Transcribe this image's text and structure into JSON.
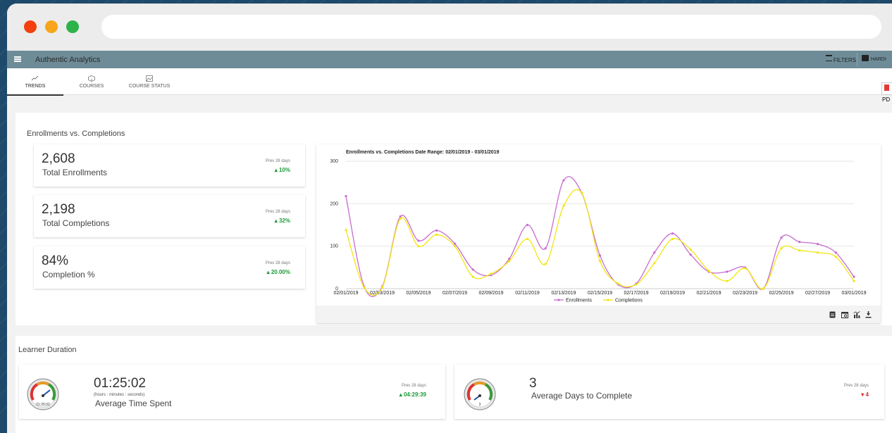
{
  "app": {
    "title": "Authentic Analytics",
    "filters_label": "FILTERS",
    "user_label": "HARDI"
  },
  "tabs": [
    {
      "label": "TRENDS",
      "icon": "line-chart-icon"
    },
    {
      "label": "COURSES",
      "icon": "cube-icon"
    },
    {
      "label": "COURSE STATUS",
      "icon": "image-icon"
    }
  ],
  "pdf_label": "PD",
  "enrollments": {
    "section_title": "Enrollments vs. Completions",
    "stats": [
      {
        "value": "2,608",
        "label": "Total Enrollments",
        "prev_label": "Prev 28 days",
        "change": "10%",
        "direction": "up"
      },
      {
        "value": "2,198",
        "label": "Total Completions",
        "prev_label": "Prev 28 days",
        "change": "32%",
        "direction": "up"
      },
      {
        "value": "84%",
        "label": "Completion %",
        "prev_label": "Prev 28 days",
        "change": "20.00%",
        "direction": "up"
      }
    ]
  },
  "chart_data": {
    "type": "line",
    "title": "Enrollments vs. Completions Date Range: 02/01/2019 - 03/01/2019",
    "ylim": [
      0,
      300
    ],
    "yticks": [
      0,
      100,
      200,
      300
    ],
    "x": [
      "02/01/2019",
      "02/02/2019",
      "02/03/2019",
      "02/04/2019",
      "02/05/2019",
      "02/06/2019",
      "02/07/2019",
      "02/08/2019",
      "02/09/2019",
      "02/10/2019",
      "02/11/2019",
      "02/12/2019",
      "02/13/2019",
      "02/14/2019",
      "02/15/2019",
      "02/16/2019",
      "02/17/2019",
      "02/18/2019",
      "02/19/2019",
      "02/20/2019",
      "02/21/2019",
      "02/22/2019",
      "02/23/2019",
      "02/24/2019",
      "02/25/2019",
      "02/26/2019",
      "02/27/2019",
      "02/28/2019",
      "03/01/2019"
    ],
    "xtick_labels": [
      "02/01/2019",
      "02/03/2019",
      "02/05/2019",
      "02/07/2019",
      "02/09/2019",
      "02/11/2019",
      "02/13/2019",
      "02/15/2019",
      "02/17/2019",
      "02/19/2019",
      "02/21/2019",
      "02/23/2019",
      "02/25/2019",
      "02/27/2019",
      "03/01/2019"
    ],
    "series": [
      {
        "name": "Enrollments",
        "color": "#c86ccf",
        "values": [
          218,
          5,
          5,
          170,
          113,
          137,
          106,
          45,
          32,
          70,
          150,
          95,
          255,
          225,
          78,
          10,
          12,
          85,
          130,
          80,
          40,
          40,
          50,
          0,
          120,
          110,
          105,
          85,
          28
        ]
      },
      {
        "name": "Completions",
        "color": "#f2e60f",
        "values": [
          138,
          3,
          3,
          165,
          100,
          127,
          100,
          28,
          35,
          65,
          117,
          58,
          195,
          225,
          65,
          12,
          10,
          60,
          117,
          92,
          42,
          18,
          48,
          0,
          95,
          90,
          85,
          75,
          18
        ]
      }
    ],
    "legend": "bottom-center",
    "grid": true
  },
  "chart_tools": [
    "document-icon",
    "calendar-icon",
    "bar-chart-icon",
    "download-icon"
  ],
  "learner_duration": {
    "section_title": "Learner Duration",
    "time_card": {
      "value": "01:25:02",
      "unit_hint": "(hours : minutes : seconds)",
      "label": "Average Time Spent",
      "gauge_value": "01:25:02",
      "prev_label": "Prev 28 days",
      "change": "04:29:39",
      "direction": "up"
    },
    "days_card": {
      "value": "3",
      "label": "Average Days to Complete",
      "gauge_value": "3",
      "prev_label": "Prev 28 days",
      "change": "4",
      "direction": "down"
    }
  },
  "colors": {
    "up": "#1c9a35",
    "down": "#d32f2f",
    "appbar": "#6e8c98"
  }
}
